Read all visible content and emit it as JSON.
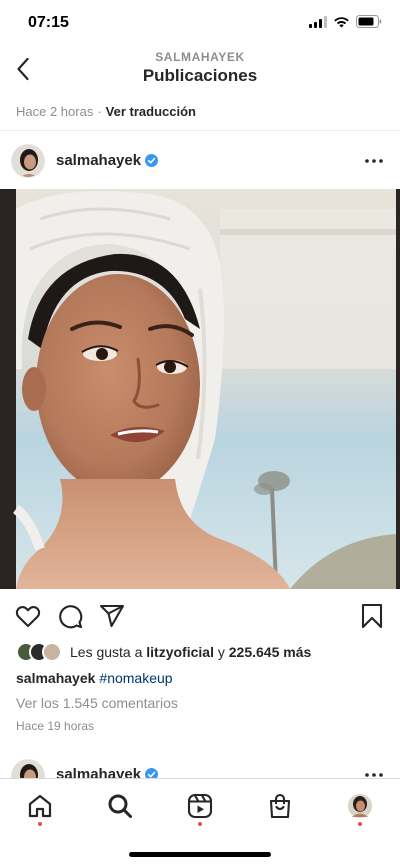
{
  "status_bar": {
    "time": "07:15"
  },
  "header": {
    "subtitle": "SALMAHAYEK",
    "title": "Publicaciones"
  },
  "previous_post": {
    "time": "Hace 2 horas",
    "separator": "·",
    "translate": "Ver traducción"
  },
  "post": {
    "username": "salmahayek",
    "likes": {
      "prefix": "Les gusta a ",
      "user": "litzyoficial",
      "middle": " y ",
      "count": "225.645 más"
    },
    "caption": {
      "username": "salmahayek",
      "hashtag": "#nomakeup"
    },
    "comments_link": "Ver los 1.545 comentarios",
    "time": "Hace 19 horas"
  },
  "next_post": {
    "username": "salmahayek"
  },
  "icons": {
    "back": "chevron-left-icon",
    "verified": "verified-badge-icon",
    "more": "more-horizontal-icon",
    "like": "heart-icon",
    "comment": "comment-icon",
    "share": "paper-plane-icon",
    "save": "bookmark-icon",
    "home": "home-icon",
    "search": "search-icon",
    "reels": "reels-icon",
    "shop": "shopping-bag-icon",
    "profile": "profile-avatar"
  },
  "colors": {
    "text": "#262626",
    "secondary": "#8e8e8e",
    "verified": "#3897f0",
    "hashtag": "#00376b",
    "notification_dot": "#ed4956"
  }
}
